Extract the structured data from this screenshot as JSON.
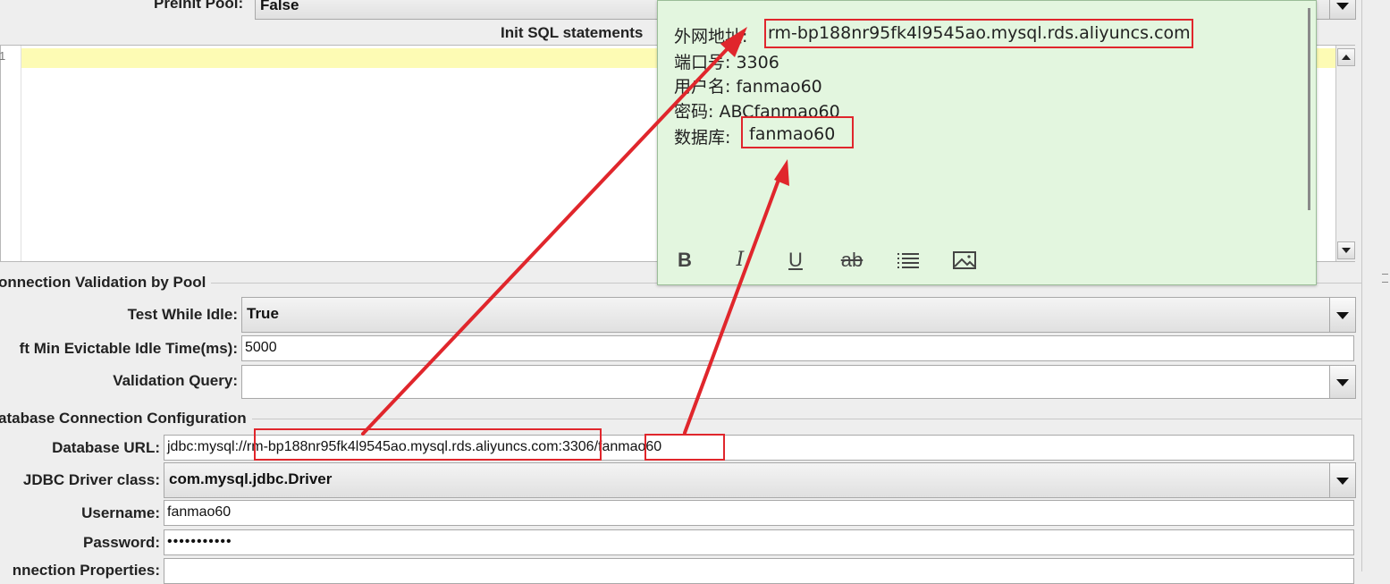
{
  "pool": {
    "preinit_label": "Preinit Pool:",
    "preinit_value": "False",
    "init_sql_header": "Init SQL statements",
    "line_number": "1"
  },
  "validation": {
    "section_title": "onnection Validation by Pool",
    "test_while_idle_label": "Test While Idle:",
    "test_while_idle_value": "True",
    "soft_min_label": "ft Min Evictable Idle Time(ms):",
    "soft_min_value": "5000",
    "validation_query_label": "Validation Query:",
    "validation_query_value": ""
  },
  "db": {
    "section_title": "atabase Connection Configuration",
    "url_label": "Database URL:",
    "url_prefix": "jdbc:mysql://",
    "url_host": "rm-bp188nr95fk4l9545ao.mysql.rds.aliyuncs.com",
    "url_port": ":3306/",
    "url_db": "fanmao60",
    "driver_label": "JDBC Driver class:",
    "driver_value": "com.mysql.jdbc.Driver",
    "username_label": "Username:",
    "username_value": "fanmao60",
    "password_label": "Password:",
    "password_value": "•••••••••••",
    "conn_props_label": "nnection Properties:"
  },
  "note": {
    "host_label": "外网地址:",
    "host_value": "rm-bp188nr95fk4l9545ao.mysql.rds.aliyuncs.com",
    "port_line": "端口号: 3306",
    "user_line": "用户名:  fanmao60",
    "pass_line": "密码: ABCfanmao60",
    "db_label": "数据库:",
    "db_value": "fanmao60",
    "toolbar": {
      "bold": "B",
      "italic": "I",
      "underline": "U",
      "strike": "ab"
    }
  },
  "colors": {
    "annotation_red": "#e0262c",
    "note_bg": "#e3f6df",
    "highlight_line": "#fdfbb4"
  },
  "icons": [
    "bold-icon",
    "italic-icon",
    "underline-icon",
    "strikethrough-icon",
    "list-icon",
    "image-icon",
    "dropdown-arrow-icon",
    "scroll-up-icon",
    "scroll-down-icon"
  ]
}
